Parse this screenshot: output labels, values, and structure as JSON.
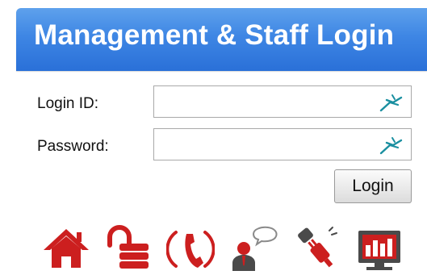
{
  "header": {
    "title": "Management & Staff Login"
  },
  "form": {
    "login_id_label": "Login ID:",
    "login_id_value": "",
    "password_label": "Password:",
    "password_value": "",
    "submit_label": "Login"
  },
  "icons": {
    "field_icon": "virtual-keyboard-icon",
    "bar": [
      "home-icon",
      "unlock-icon",
      "phone-icon",
      "staff-chat-icon",
      "plug-icon",
      "presentation-icon"
    ]
  },
  "colors": {
    "header_blue": "#3e86e4",
    "icon_red": "#cc1f1f",
    "key_teal": "#1a8fa0"
  }
}
